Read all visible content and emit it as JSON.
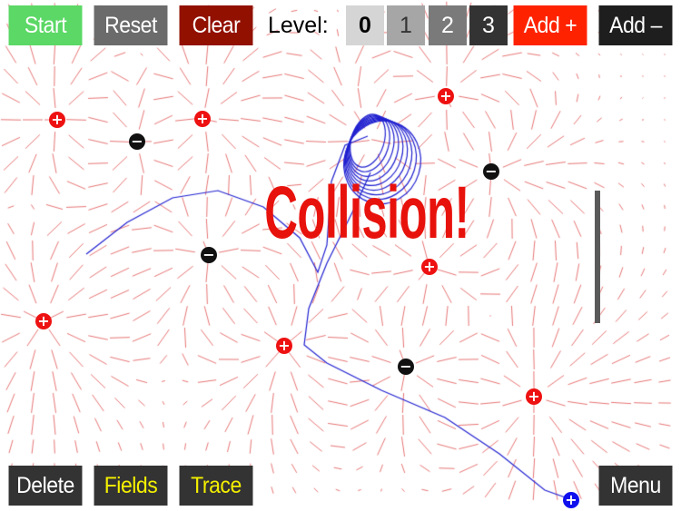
{
  "toolbar": {
    "start": "Start",
    "reset": "Reset",
    "clear": "Clear",
    "level_label": "Level:",
    "levels": [
      "0",
      "1",
      "2",
      "3"
    ],
    "selected_level": "0",
    "add_plus": "Add +",
    "add_minus": "Add –"
  },
  "status": {
    "message": "Collision!"
  },
  "bottom": {
    "delete": "Delete",
    "fields": "Fields",
    "trace": "Trace",
    "menu": "Menu"
  },
  "colors": {
    "start": "#5bd865",
    "reset": "#6b6b6b",
    "clear": "#921000",
    "add_plus": "#ff2200",
    "add_minus": "#1e1e1e",
    "field_lines": "#e05050",
    "trace": "#2020d0",
    "positive_charge": "#ee1111",
    "negative_charge": "#111111",
    "probe": "#1010ee"
  },
  "icons": {
    "positive": "plus-charge-icon",
    "negative": "minus-charge-icon",
    "probe": "probe-charge-icon"
  }
}
